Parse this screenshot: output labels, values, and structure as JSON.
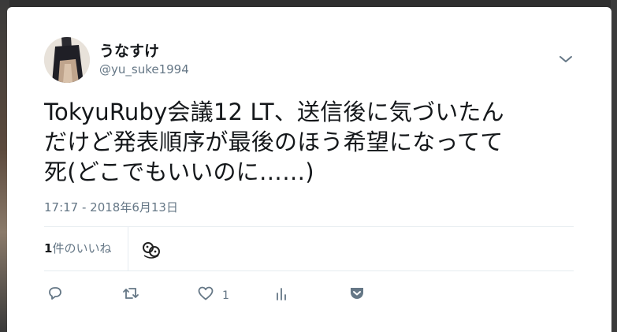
{
  "tweet": {
    "author": {
      "display_name": "うなすけ",
      "screen_name": "@yu_suke1994",
      "avatar_icon": "user-avatar"
    },
    "text": "TokyuRuby会議12 LT、送信後に気づいたん\nだけど発表順序が最後のほう希望になってて\n死(どこでもいいのに……)",
    "timestamp": "17:17 - 2018年6月13日",
    "stats": {
      "likes_number": "1",
      "likes_label": "件のいいね"
    },
    "actions": {
      "reply_icon": "reply-icon",
      "retweet_icon": "retweet-icon",
      "like_icon": "heart-icon",
      "like_count": "1",
      "analytics_icon": "bar-chart-icon",
      "save_icon": "pocket-icon"
    },
    "menu_icon": "chevron-down-icon"
  },
  "colors": {
    "text_primary": "#14171a",
    "text_secondary": "#657786",
    "divider": "#e6ecf0",
    "background": "#ffffff"
  }
}
